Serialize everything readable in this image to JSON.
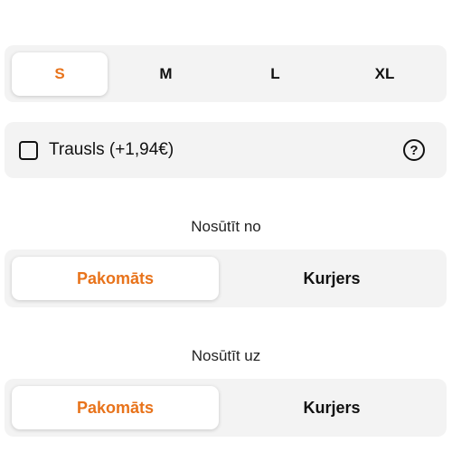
{
  "sizes": {
    "options": [
      "S",
      "M",
      "L",
      "XL"
    ],
    "selected": "S"
  },
  "fragile": {
    "label": "Trausls (+1,94€)",
    "checked": false,
    "help_icon": "question-circle-icon"
  },
  "send_from": {
    "label": "Nosūtīt no",
    "options": [
      "Pakomāts",
      "Kurjers"
    ],
    "selected": "Pakomāts"
  },
  "send_to": {
    "label": "Nosūtīt uz",
    "options": [
      "Pakomāts",
      "Kurjers"
    ],
    "selected": "Pakomāts"
  },
  "colors": {
    "accent": "#e8731b",
    "segment_bg": "#f3f3f3",
    "text": "#111111"
  }
}
